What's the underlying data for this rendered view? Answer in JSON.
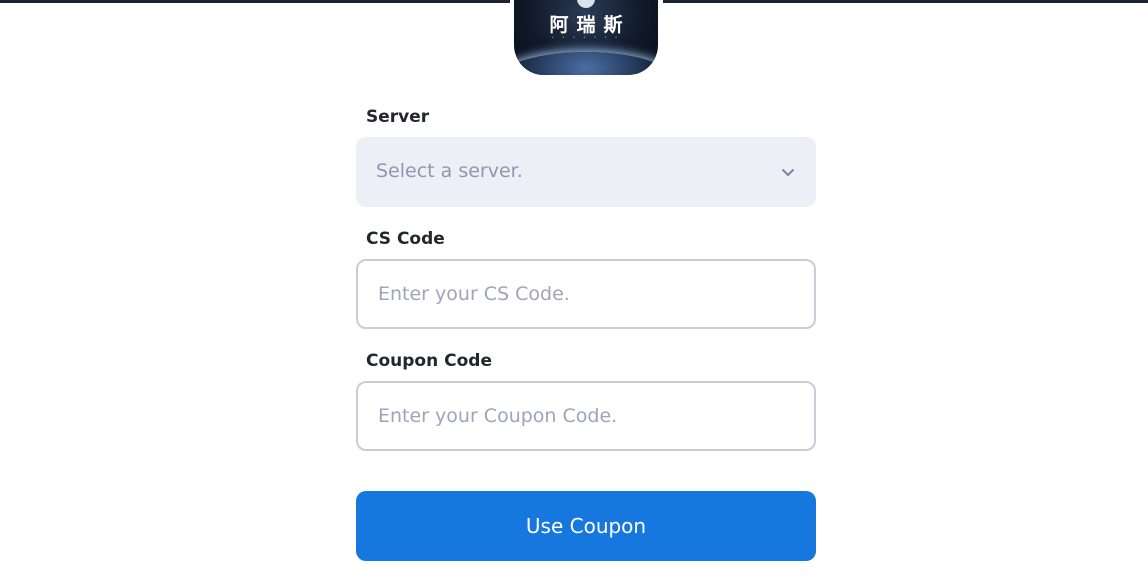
{
  "logo": {
    "text": "阿瑞斯",
    "dots": "• • • • • • •"
  },
  "form": {
    "server": {
      "label": "Server",
      "selected_text": "Select a server.",
      "icon": "chevron-down-icon"
    },
    "cs_code": {
      "label": "CS Code",
      "placeholder": "Enter your CS Code.",
      "value": ""
    },
    "coupon_code": {
      "label": "Coupon Code",
      "placeholder": "Enter your Coupon Code.",
      "value": ""
    },
    "submit_label": "Use Coupon"
  },
  "colors": {
    "top_bar": "#1c2330",
    "select_bg": "#edeef6",
    "input_border": "#cbcbdd",
    "button_bg": "#1677de",
    "label_text": "#23262d",
    "placeholder_text": "#9197b1"
  }
}
